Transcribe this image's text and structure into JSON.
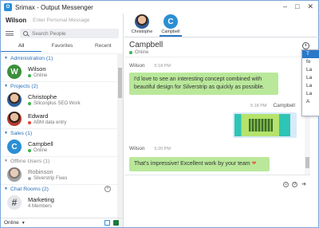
{
  "window": {
    "title": "Srimax - Output Messenger",
    "controls": [
      "–",
      "□",
      "✕"
    ]
  },
  "me": {
    "name": "Wilson",
    "personal_message_placeholder": "Enter Personal Message"
  },
  "search": {
    "placeholder": "Search People"
  },
  "tabs": [
    "All",
    "Favorites",
    "Recent"
  ],
  "groups": {
    "administration": {
      "label": "Administration (1)"
    },
    "projects": {
      "label": "Projects (2)"
    },
    "sales": {
      "label": "Sales (1)"
    },
    "offline": {
      "label": "Offline Users (1)"
    },
    "chatrooms": {
      "label": "Chat Rooms (2)"
    }
  },
  "contacts": {
    "wilson": {
      "name": "Wilson",
      "status": "Online",
      "initial": "W"
    },
    "christophe": {
      "name": "Christophe",
      "status": "Siliconplus SEO Work"
    },
    "edward": {
      "name": "Edward",
      "status": "ABM data entry"
    },
    "campbell": {
      "name": "Campbell",
      "status": "Online",
      "initial": "C"
    },
    "robinson": {
      "name": "Robinson",
      "status": "Silverstrip Fixes"
    },
    "marketing": {
      "name": "Marketing",
      "status": "4 Members",
      "initial": "#"
    }
  },
  "statusbar": {
    "status": "Online"
  },
  "conversation_tabs": [
    {
      "label": "Christophe"
    },
    {
      "label": "Campbell",
      "initial": "C"
    }
  ],
  "conversation": {
    "name": "Campbell",
    "status": "Online",
    "messages": [
      {
        "sender": "Wilson",
        "time": "5:18 PM",
        "text_line1": "I'd love to see an interesting concept combined with",
        "text_line2": "beautiful design for Silverstrip as quickly as possible."
      },
      {
        "sender": "Campbell",
        "time": "5:18 PM"
      },
      {
        "sender": "Wilson",
        "time": "5:20 PM",
        "text": "That's impressive! Excellent work by your team"
      }
    ]
  },
  "dropdown": {
    "items": [
      "T",
      "fo",
      "La",
      "La",
      "La",
      "La",
      "A"
    ]
  }
}
